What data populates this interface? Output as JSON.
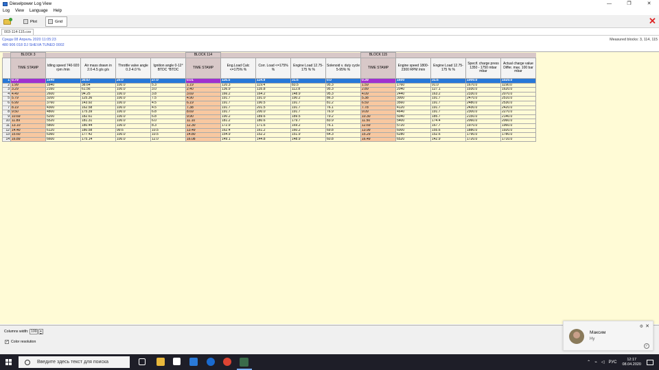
{
  "window": {
    "title": "Dieselpower Log View",
    "buttons": {
      "minimize": "—",
      "maximize": "❐",
      "close": "✕"
    }
  },
  "menu": [
    "Log",
    "View",
    "Language",
    "Help"
  ],
  "toolbar": {
    "plot_label": "Plot",
    "grid_label": "Grid"
  },
  "file_tab": "003-114-115.csv",
  "info": {
    "line1": "Среда 08 Апрель 2020 11:05:23",
    "line2": "480 906 018 DJ  SHEVA TUNED       0002",
    "measured_blocks": "Measured blocks: 3, 114, 115"
  },
  "grid": {
    "blocks": [
      {
        "label": "BLOCK 3",
        "span": 5
      },
      {
        "label": "BLOCK 114",
        "span": 5
      },
      {
        "label": "BLOCK 115",
        "span": 5
      }
    ],
    "headers": [
      "TIME STAMP",
      "Idling speed 740-920 rpm /min",
      "Air mass drawn in 2.0-4.5 g/s g/s",
      "Throttle valve angle 0.2-4.0 %",
      "Ignition angle 0-12° BTDC °BTDC",
      "TIME STAMP",
      "Eng.Load Calc <=175% %",
      "Corr. Load <=175% %",
      "Engine Load 12.75-175 % %",
      "Solenoid v. duty cycle 5-95% %",
      "TIME STAMP",
      "Engine speed 1800-2300 RPM /min",
      "Engine Load 12.75-175 % %",
      "Specif. charge press 1350 - 1750 mbar mbar",
      "Actual charge value Differ. max. 100 bar mbar"
    ],
    "rows": [
      [
        "1",
        "0.79",
        "1640",
        "30.67",
        "20.0",
        "27.0",
        "0.01",
        "116.5",
        "114.9",
        "31.6",
        "0.0",
        "0.39",
        "1600",
        "31.6",
        "1000.0",
        "1020.0"
      ],
      [
        "2",
        "1.99",
        "1840",
        "38.64",
        "100.0",
        "5.3",
        "1.19",
        "120.3",
        "119.4",
        "83.5",
        "95.3",
        "1.59",
        "1760",
        "91.0",
        "1670.0",
        "1190.0"
      ],
      [
        "3",
        "3.29",
        "2160",
        "61.56",
        "100.0",
        "3.0",
        "2.40",
        "136.9",
        "135.8",
        "112.8",
        "95.3",
        "2.89",
        "2040",
        "127.1",
        "1930.0",
        "1620.0"
      ],
      [
        "4",
        "4.49",
        "2600",
        "94.25",
        "100.0",
        "3.8",
        "3.69",
        "166.2",
        "164.2",
        "148.9",
        "95.3",
        "4.09",
        "2440",
        "163.2",
        "2330.0",
        "2070.0"
      ],
      [
        "5",
        "5.79",
        "3200",
        "125.36",
        "100.0",
        "7.5",
        "4.90",
        "191.7",
        "191.0",
        "190.2",
        "86.3",
        "5.38",
        "3000",
        "191.7",
        "2470.0",
        "2510.0"
      ],
      [
        "6",
        "6.99",
        "3760",
        "143.92",
        "100.0",
        "4.5",
        "6.19",
        "191.7",
        "190.5",
        "191.7",
        "81.2",
        "6.59",
        "3560",
        "191.7",
        "2480.0",
        "2530.0"
      ],
      [
        "7",
        "8.19",
        "4300",
        "162.58",
        "100.0",
        "4.5",
        "7.38",
        "191.7",
        "201.5",
        "191.7",
        "76.1",
        "7.78",
        "4120",
        "191.7",
        "2430.0",
        "2420.0"
      ],
      [
        "8",
        "9.50",
        "4800",
        "175.39",
        "100.0",
        "6.8",
        "8.69",
        "191.7",
        "200.0",
        "191.7",
        "76.9",
        "9.09",
        "4640",
        "191.7",
        "2300.0",
        "2270.0"
      ],
      [
        "9",
        "10.69",
        "5200",
        "182.61",
        "100.0",
        "6.8",
        "9.90",
        "190.2",
        "189.6",
        "189.5",
        "79.2",
        "10.30",
        "5040",
        "185.7",
        "2150.0",
        "2140.0"
      ],
      [
        "10",
        "11.89",
        "5520",
        "181.31",
        "100.0",
        "6.0",
        "11.10",
        "181.2",
        "180.6",
        "179.7",
        "83.9",
        "11.50",
        "5400",
        "174.4",
        "2060.0",
        "2060.0"
      ],
      [
        "11",
        "13.10",
        "5800",
        "180.44",
        "100.0",
        "8.3",
        "12.30",
        "172.9",
        "171.6",
        "169.2",
        "76.1",
        "12.69",
        "5720",
        "167.7",
        "1970.0",
        "1960.0"
      ],
      [
        "12",
        "14.40",
        "6120",
        "180.58",
        "99.6",
        "10.5",
        "13.49",
        "162.4",
        "161.2",
        "160.2",
        "69.8",
        "13.99",
        "6000",
        "155.6",
        "1880.0",
        "1920.0"
      ],
      [
        "13",
        "15.60",
        "6360",
        "177.42",
        "100.0",
        "10.5",
        "14.80",
        "154.9",
        "152.2",
        "151.9",
        "64.3",
        "15.29",
        "6280",
        "152.6",
        "1790.0",
        "1780.0"
      ],
      [
        "14",
        "16.89",
        "6600",
        "175.14",
        "100.0",
        "12.0",
        "16.08",
        "149.1",
        "144.8",
        "148.9",
        "60.8",
        "16.49",
        "6520",
        "142.9",
        "1720.0",
        "1710.0"
      ]
    ]
  },
  "bottom": {
    "column_width_label": "Columns width:",
    "column_width_value": "100",
    "color_resolution_label": "Color resolution",
    "color_resolution_checked": "✓"
  },
  "notification": {
    "name": "Максим",
    "message": "Ну"
  },
  "taskbar": {
    "search_placeholder": "Введите здесь текст для поиска",
    "lang": "РУС",
    "time": "12:17",
    "date": "08.04.2020"
  },
  "colors": {
    "grid_bg": "#fffbd6",
    "timestamp_col": "#f8c8a0",
    "block_header": "#d8c8c8",
    "selected_row": "#2878d8",
    "selected_timestamp": "#a030d0",
    "info_text": "#3a5ad8"
  }
}
